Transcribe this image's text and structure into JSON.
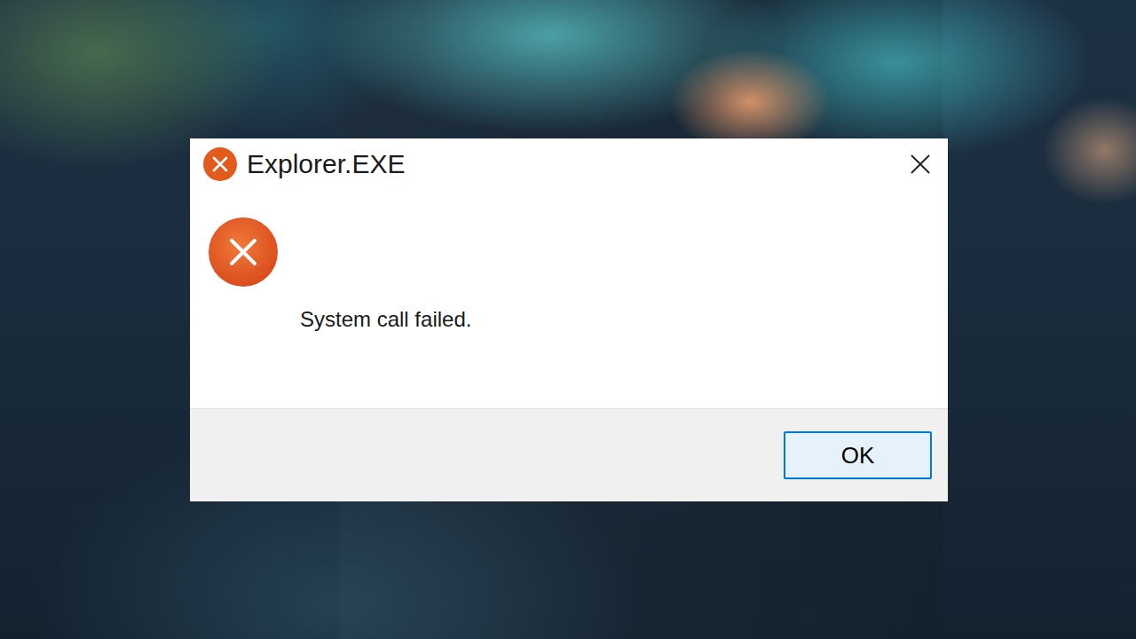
{
  "window": {
    "title": "Explorer.EXE"
  },
  "message": "System call failed.",
  "buttons": [
    {
      "label": "OK",
      "selected": true
    }
  ]
}
